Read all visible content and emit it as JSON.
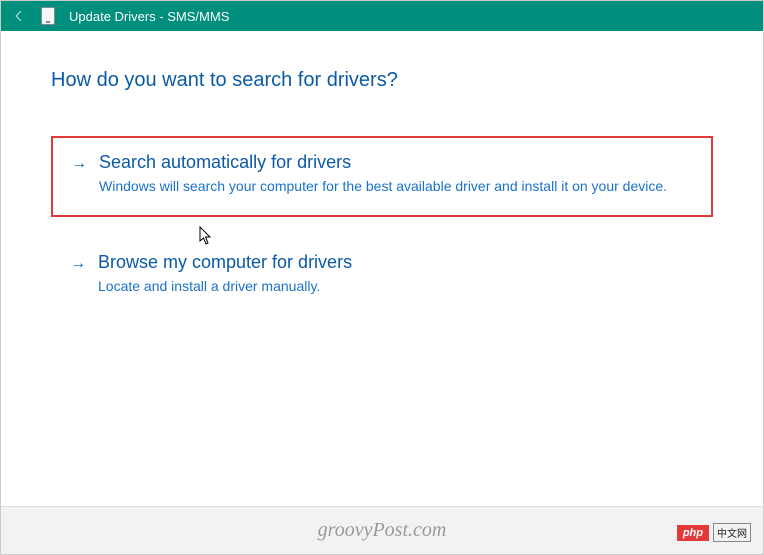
{
  "window": {
    "title": "Update Drivers - SMS/MMS"
  },
  "heading": "How do you want to search for drivers?",
  "options": [
    {
      "title": "Search automatically for drivers",
      "description": "Windows will search your computer for the best available driver and install it on your device.",
      "highlighted": true
    },
    {
      "title": "Browse my computer for drivers",
      "description": "Locate and install a driver manually.",
      "highlighted": false
    }
  ],
  "watermark": "groovyPost.com",
  "badge": {
    "left": "php",
    "right": "中文网"
  }
}
